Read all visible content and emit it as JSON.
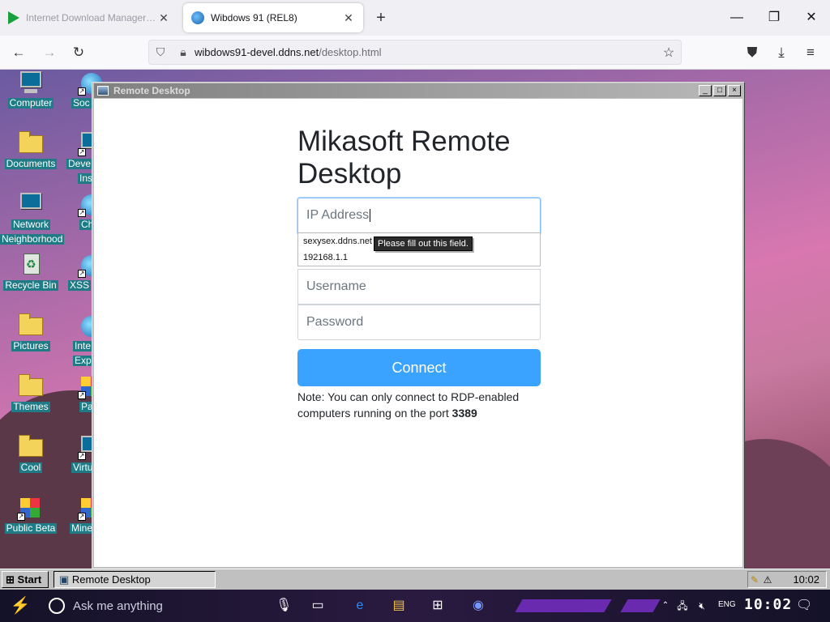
{
  "browser": {
    "tabs": [
      {
        "label": "Internet Download Manager: The f...",
        "active": false
      },
      {
        "label": "Wibdows 91 (REL8)",
        "active": true
      }
    ],
    "new_tab": "+",
    "window_controls": {
      "minimize": "—",
      "maximize": "❐",
      "close": "✕"
    },
    "nav": {
      "back": "←",
      "forward": "→",
      "reload": "↻"
    },
    "url": {
      "host": "wibdows91-devel.ddns.net",
      "path": "/desktop.html"
    },
    "toolbar_icons": [
      "pocket-icon",
      "download-icon",
      "menu-icon"
    ]
  },
  "desktop_icons": {
    "computer": "Computer",
    "social": "Soc",
    "documents": "Documents",
    "developer_line1": "Deve",
    "developer_line2": "Ins",
    "network_line1": "Network",
    "network_line2": "Neighborhood",
    "chrome": "Ch",
    "recycle_bin": "Recycle Bin",
    "xss": "XSS",
    "pictures": "Pictures",
    "internet_line1": "Inte",
    "internet_line2": "Expl",
    "themes": "Themes",
    "paint": "Pa",
    "cool": "Cool",
    "virtual": "Virtu",
    "public_beta": "Public Beta",
    "minecraft": "Mine"
  },
  "remote_desktop": {
    "window_title": "Remote Desktop",
    "heading": "Mikasoft Remote Desktop",
    "ip_placeholder": "IP Address",
    "username_placeholder": "Username",
    "password_placeholder": "Password",
    "autocomplete": [
      "sexysex.ddns.net",
      "192168.1.1"
    ],
    "tooltip": "Please fill out this field.",
    "connect_label": "Connect",
    "note_prefix": "Note: You can only connect to RDP-enabled computers running on the port ",
    "note_port": "3389"
  },
  "w9_taskbar": {
    "start_label": "Start",
    "task_label": "Remote Desktop",
    "clock": "10:02"
  },
  "host_taskbar": {
    "search_placeholder": "Ask me anything",
    "lang": "ENG",
    "clock": "10:02"
  },
  "colors": {
    "connect_button": "#3aa3ff",
    "desktop_label_bg": "#1f7b86",
    "titlebar_inactive": "#808080"
  }
}
